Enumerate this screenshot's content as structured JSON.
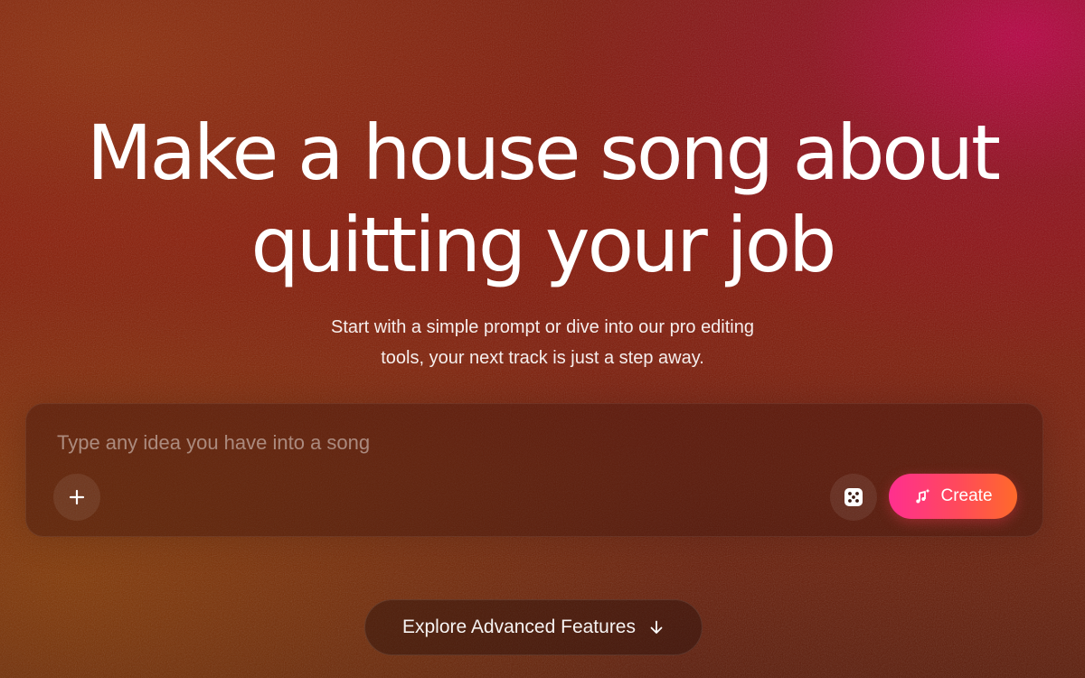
{
  "hero": {
    "title_line1": "Make a house song about",
    "title_line2": "quitting your job",
    "subtitle_line1": "Start with a simple prompt or dive into our pro editing",
    "subtitle_line2": "tools, your next track is just a step away."
  },
  "prompt": {
    "value": "",
    "placeholder": "Type any idea you have into a song",
    "add_icon": "plus-icon",
    "random_icon": "dice-icon",
    "create_icon": "music-note-sparkle-icon",
    "create_label": "Create"
  },
  "explore": {
    "label": "Explore Advanced Features",
    "icon": "arrow-down-icon"
  },
  "colors": {
    "create_gradient_start": "#ff2f8f",
    "create_gradient_end": "#ff6a2a",
    "background_primary": "#861507",
    "background_accent": "#b90046"
  }
}
